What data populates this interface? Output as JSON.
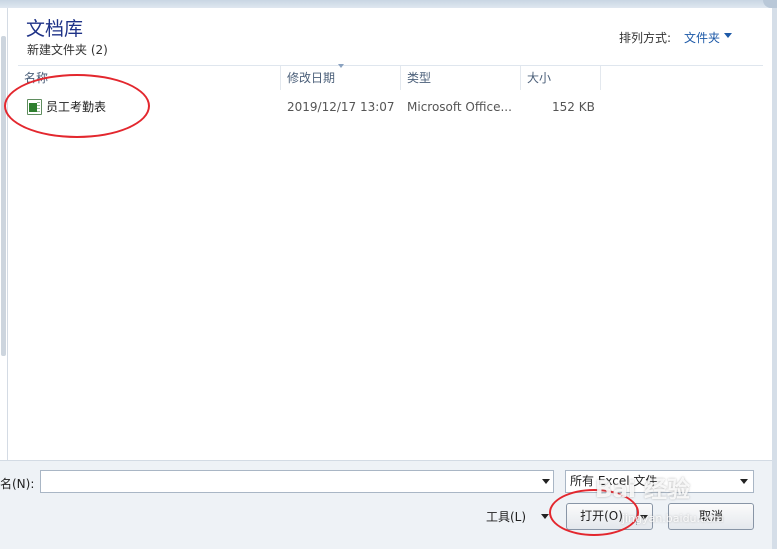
{
  "library": {
    "title": "文档库",
    "subtitle": "新建文件夹 (2)",
    "arrange_label": "排列方式:",
    "arrange_value": "文件夹"
  },
  "columns": [
    "名称",
    "修改日期",
    "类型",
    "大小"
  ],
  "files": [
    {
      "name": "员工考勤表",
      "modified": "2019/12/17 13:07",
      "type": "Microsoft Office...",
      "size": "152 KB",
      "icon": "excel-file-icon"
    }
  ],
  "footer": {
    "filename_label": "名(N):",
    "filename_value": "",
    "filter_value": "所有 Excel 文件",
    "tools_label": "工具(L)",
    "open_label": "打开(O)",
    "cancel_label": "取消"
  },
  "colors": {
    "title": "#1e3287",
    "arrange_value": "#1e5aa8",
    "annotation": "#e3272e"
  },
  "watermark": {
    "text": "Bai 经验",
    "url": "jingyan.baidu.com"
  }
}
